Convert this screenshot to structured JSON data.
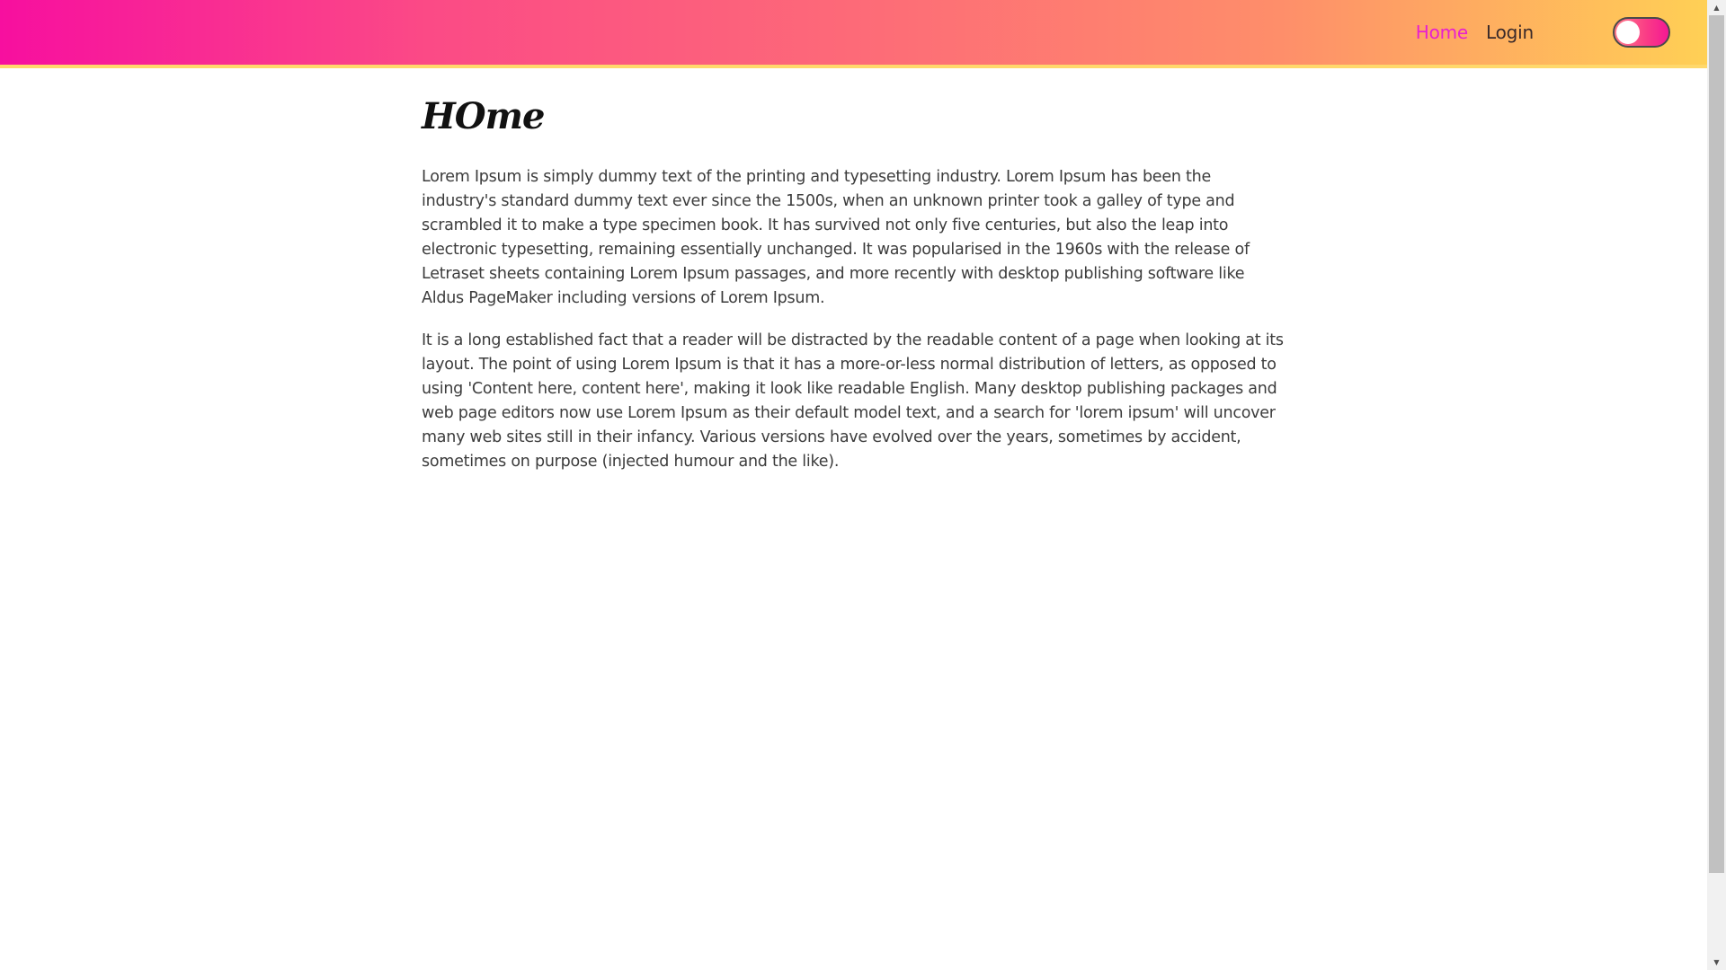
{
  "nav": {
    "home_label": "Home",
    "login_label": "Login",
    "theme_toggle_on": false
  },
  "main": {
    "title": "HOme",
    "paragraphs": [
      "Lorem Ipsum is simply dummy text of the printing and typesetting industry. Lorem Ipsum has been the industry's standard dummy text ever since the 1500s, when an unknown printer took a galley of type and scrambled it to make a type specimen book. It has survived not only five centuries, but also the leap into electronic typesetting, remaining essentially unchanged. It was popularised in the 1960s with the release of Letraset sheets containing Lorem Ipsum passages, and more recently with desktop publishing software like Aldus PageMaker including versions of Lorem Ipsum.",
      "It is a long established fact that a reader will be distracted by the readable content of a page when looking at its layout. The point of using Lorem Ipsum is that it has a more-or-less normal distribution of letters, as opposed to using 'Content here, content here', making it look like readable English. Many desktop publishing packages and web page editors now use Lorem Ipsum as their default model text, and a search for 'lorem ipsum' will uncover many web sites still in their infancy. Various versions have evolved over the years, sometimes by accident, sometimes on purpose (injected humour and the like)."
    ]
  },
  "colors": {
    "nav_gradient_start": "#f70f9f",
    "nav_gradient_end": "#ffd055",
    "active_link": "#e81fd0",
    "text": "#3c3c3c"
  }
}
